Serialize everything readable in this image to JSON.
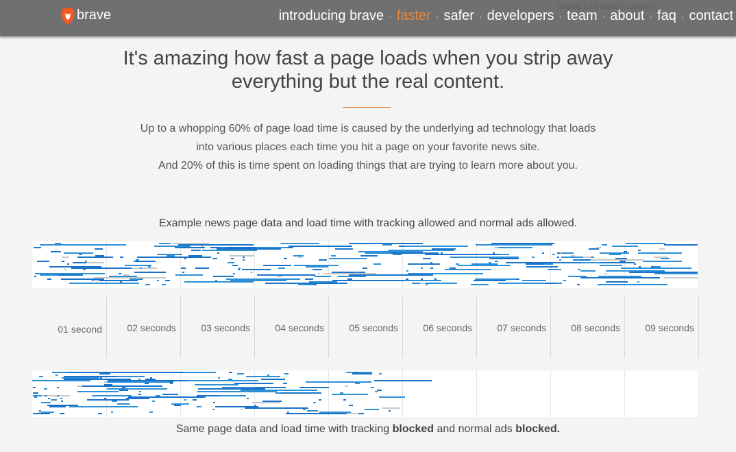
{
  "header": {
    "logo_text": "brave",
    "tagline": "helping fund content creators",
    "nav": [
      {
        "label": "introducing brave",
        "active": false
      },
      {
        "label": "faster",
        "active": true
      },
      {
        "label": "safer",
        "active": false
      },
      {
        "label": "developers",
        "active": false
      },
      {
        "label": "team",
        "active": false
      },
      {
        "label": "about",
        "active": false
      },
      {
        "label": "faq",
        "active": false
      },
      {
        "label": "contact",
        "active": false
      }
    ],
    "separator": "·"
  },
  "headline": {
    "line1": "It's amazing how fast a page loads when you strip away",
    "line2": "everything but the real content."
  },
  "intro": {
    "line1": "Up to a whopping 60% of page load time is caused by the underlying ad technology that loads",
    "line2": "into various places each time you hit a page on your favorite news site.",
    "line3": "And 20% of this is time spent on loading things that are trying to learn more about you."
  },
  "top_caption": "Example news page data and load time with tracking allowed and normal ads allowed.",
  "timeline_labels": [
    "01 second",
    "02 seconds",
    "03 seconds",
    "04 seconds",
    "05 seconds",
    "06 seconds",
    "07 seconds",
    "08 seconds",
    "09 seconds"
  ],
  "bottom_caption": {
    "prefix": "Same page data and load time with tracking ",
    "bold1": "blocked",
    "middle": " and normal ads ",
    "bold2": "blocked."
  },
  "colors": {
    "accent": "#e8883a",
    "bar_blue": "#1a73c9",
    "bar_gray": "#c8c8c8",
    "header_bg": "#707070"
  }
}
